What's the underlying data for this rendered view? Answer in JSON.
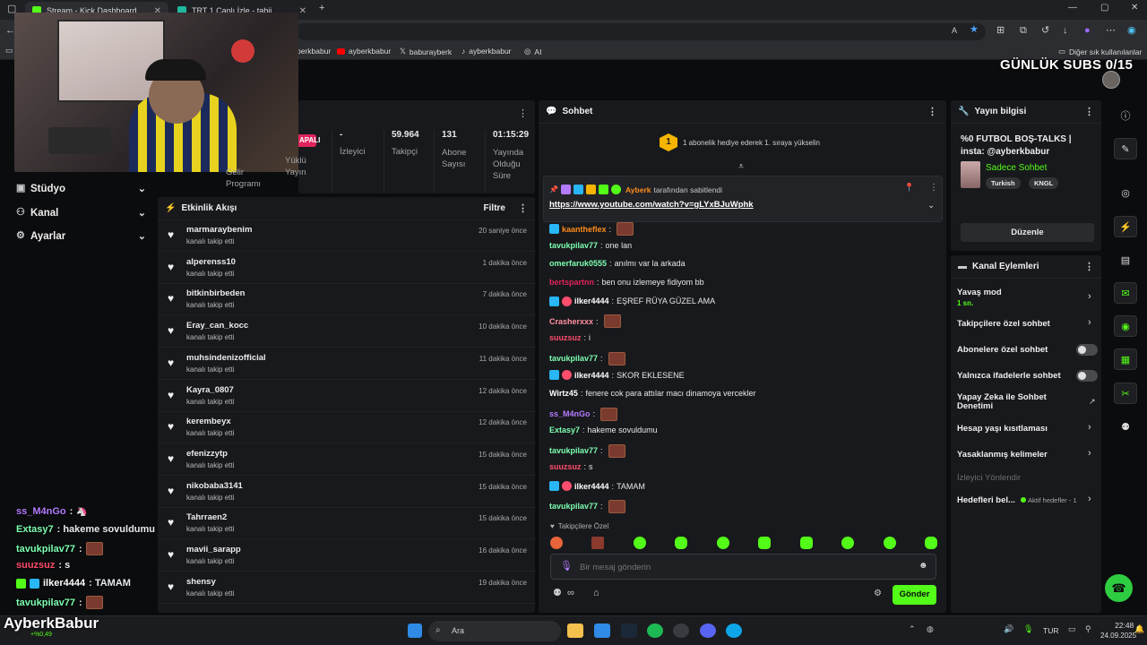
{
  "browser": {
    "tabs": [
      {
        "title": "Stream - Kick Dashboard",
        "active": true
      },
      {
        "title": "TRT 1 Canlı İzle - tabii",
        "active": false
      }
    ],
    "bookmarks": [
      "ayberkbabur",
      "ayberkbabur",
      "baburayberk",
      "ayberkbabur",
      "AI"
    ],
    "other_bookmarks": "Diğer sık kullanılanlar"
  },
  "overlay": {
    "subs_goal": "GÜNLÜK SUBS 0/15",
    "streamer_name": "AyberkBabur",
    "streamer_sub": "+%0,49",
    "chat": [
      {
        "user": "ss_M4nGo",
        "text": ":",
        "color": "#b37bff"
      },
      {
        "user": "Extasy7",
        "text": ": hakeme sovuldumu",
        "color": "#7dffb0"
      },
      {
        "user": "tavukpilav77",
        "text": ":",
        "color": "#7dffb0"
      },
      {
        "user": "suuzsuz",
        "text": ": s",
        "color": "#ff4d6d"
      },
      {
        "user": "ilker4444",
        "text": ": TAMAM",
        "color": "#ffffff"
      },
      {
        "user": "tavukpilav77",
        "text": ":",
        "color": "#7dffb0"
      }
    ]
  },
  "sidebar_nav": [
    {
      "label": "Stüdyo",
      "icon": "studio-icon"
    },
    {
      "label": "Kanal",
      "icon": "channel-icon"
    },
    {
      "label": "Ayarlar",
      "icon": "gear-icon"
    }
  ],
  "stream_stats": {
    "status_badge": "APALI",
    "items": [
      {
        "value": "",
        "label": "Gelir Programı"
      },
      {
        "value": "",
        "label": "Yüklü Yayın"
      },
      {
        "value": "-",
        "label": "İzleyici"
      },
      {
        "value": "59.964",
        "label": "Takipçi"
      },
      {
        "value": "131",
        "label": "Abone Sayısı"
      },
      {
        "value": "01:15:29",
        "label": "Yayında Olduğu Süre"
      }
    ]
  },
  "activity": {
    "title": "Etkinlik Akışı",
    "filter_label": "Filtre",
    "events": [
      {
        "name": "marmaraybenim",
        "action": "kanalı takip etti",
        "time": "20 saniye önce"
      },
      {
        "name": "alperenss10",
        "action": "kanalı takip etti",
        "time": "1 dakika önce"
      },
      {
        "name": "bitkinbirbeden",
        "action": "kanalı takip etti",
        "time": "7 dakika önce"
      },
      {
        "name": "Eray_can_kocc",
        "action": "kanalı takip etti",
        "time": "10 dakika önce"
      },
      {
        "name": "muhsindenizofficial",
        "action": "kanalı takip etti",
        "time": "11 dakika önce"
      },
      {
        "name": "Kayra_0807",
        "action": "kanalı takip etti",
        "time": "12 dakika önce"
      },
      {
        "name": "kerembeyx",
        "action": "kanalı takip etti",
        "time": "12 dakika önce"
      },
      {
        "name": "efenizzytp",
        "action": "kanalı takip etti",
        "time": "15 dakika önce"
      },
      {
        "name": "nikobaba3141",
        "action": "kanalı takip etti",
        "time": "15 dakika önce"
      },
      {
        "name": "Tahrraen2",
        "action": "kanalı takip etti",
        "time": "15 dakika önce"
      },
      {
        "name": "mavii_sarapp",
        "action": "kanalı takip etti",
        "time": "16 dakika önce"
      },
      {
        "name": "shensy",
        "action": "kanalı takip etti",
        "time": "19 dakika önce"
      }
    ]
  },
  "chat": {
    "title": "Sohbet",
    "gift_rank": "1",
    "gift_text": "1 abonelik hediye ederek 1. sıraya yükselin",
    "pinned_by_user": "Ayberk",
    "pinned_by_text": "tarafından sabitlendi",
    "pinned_link": "https://www.youtube.com/watch?v=gLYxBJuWphk",
    "messages": [
      {
        "user": "kaantheflex",
        "color": "#ff8c1a",
        "text": "",
        "emote": true
      },
      {
        "user": "tavukpilav77",
        "color": "#7dffb0",
        "text": "one lan",
        "emote": false
      },
      {
        "user": "omerfaruk0555",
        "color": "#7dffb0",
        "text": "anılmı var la arkada",
        "emote": false
      },
      {
        "user": "bertspartnn",
        "color": "#e0245e",
        "text": "ben onu izlemeye fidiyom bb",
        "emote": false
      },
      {
        "user": "ilker4444",
        "color": "#ffffff",
        "text": "EŞREF RÜYA GÜZEL AMA",
        "emote": false
      },
      {
        "user": "Crasherxxx",
        "color": "#ff8fa0",
        "text": "",
        "emote": true
      },
      {
        "user": "suuzsuz",
        "color": "#ff4d6d",
        "text": "i",
        "emote": false
      },
      {
        "user": "tavukpilav77",
        "color": "#7dffb0",
        "text": "",
        "emote": true
      },
      {
        "user": "ilker4444",
        "color": "#ffffff",
        "text": "SKOR EKLESENE",
        "emote": false
      },
      {
        "user": "Wirtz45",
        "color": "#ffffff",
        "text": "fenere cok para attılar macı dinamoya vercekler",
        "emote": false
      },
      {
        "user": "ss_M4nGo",
        "color": "#b37bff",
        "text": "",
        "emote": true
      },
      {
        "user": "Extasy7",
        "color": "#7dffb0",
        "text": "hakeme sovuldumu",
        "emote": false
      },
      {
        "user": "tavukpilav77",
        "color": "#7dffb0",
        "text": "",
        "emote": true
      },
      {
        "user": "suuzsuz",
        "color": "#ff4d6d",
        "text": "s",
        "emote": false
      },
      {
        "user": "ilker4444",
        "color": "#ffffff",
        "text": "TAMAM",
        "emote": false
      },
      {
        "user": "tavukpilav77",
        "color": "#7dffb0",
        "text": "",
        "emote": true
      }
    ],
    "follower_only_label": "Takipçilere Özel",
    "input_placeholder": "Bir mesaj gönderin",
    "send_label": "Gönder"
  },
  "stream_info": {
    "title": "Yayın bilgisi",
    "stream_title": "%0 FUTBOL BOŞ-TALKS | insta: @ayberkbabur",
    "category": "Sadece Sohbet",
    "tags": [
      "Turkish",
      "KNGL"
    ],
    "edit_label": "Düzenle"
  },
  "channel_actions": {
    "title": "Kanal Eylemleri",
    "slow_mode": "Yavaş mod",
    "slow_mode_value": "1 sn.",
    "followers_only": "Takipçilere özel sohbet",
    "subs_only": "Abonelere özel sohbet",
    "emotes_only": "Yalnızca ifadelerle sohbet",
    "ai_moderation": "Yapay Zeka ile Sohbet Denetimi",
    "age_restriction": "Hesap yaşı kısıtlaması",
    "banned_words": "Yasaklanmış kelimeler",
    "redirect_viewers": "İzleyici Yönlendir",
    "goals": "Hedefleri bel...",
    "goals_status": "Aktif hedefler - 1"
  },
  "taskbar": {
    "search_placeholder": "Ara",
    "language": "TUR",
    "time": "22:48",
    "date": "24.09.2025"
  },
  "colors": {
    "accent": "#53fc18",
    "panel": "#18191c",
    "background": "#0b0c0e"
  }
}
